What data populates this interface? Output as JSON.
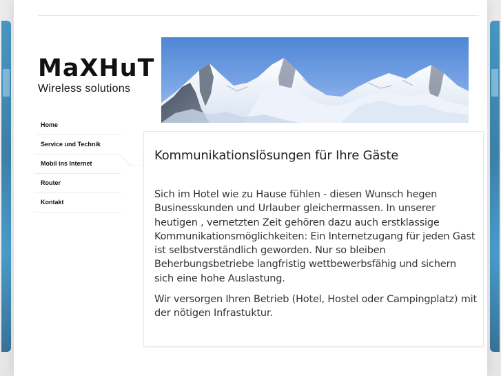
{
  "logo": {
    "mark": "MaXHuT",
    "tagline": "Wireless solutions"
  },
  "nav": {
    "items": [
      {
        "label": "Home"
      },
      {
        "label": "Service und Technik"
      },
      {
        "label": "Mobil ins Internet"
      },
      {
        "label": "Router"
      },
      {
        "label": "Kontakt"
      }
    ],
    "active_index": 2
  },
  "content": {
    "title": "Kommunikationslösungen für Ihre Gäste",
    "paragraphs": [
      "Sich im Hotel wie zu Hause fühlen - diesen Wunsch hegen Businesskunden und Urlauber gleichermassen. In unserer heutigen , vernetzten Zeit gehören dazu auch erstklassige Kommunikationsmöglichkeiten: Ein Internetzugang für jeden Gast ist selbstverständlich geworden. Nur so bleiben Beherbungsbetriebe langfristig wettbewerbsfähig und sichern sich eine hohe Auslastung.",
      "Wir versorgen Ihren Betrieb (Hotel, Hostel oder Campingplatz) mit der nötigen Infrastuktur."
    ]
  },
  "colors": {
    "accent_blue": "#2b8bbf",
    "text": "#333333"
  }
}
